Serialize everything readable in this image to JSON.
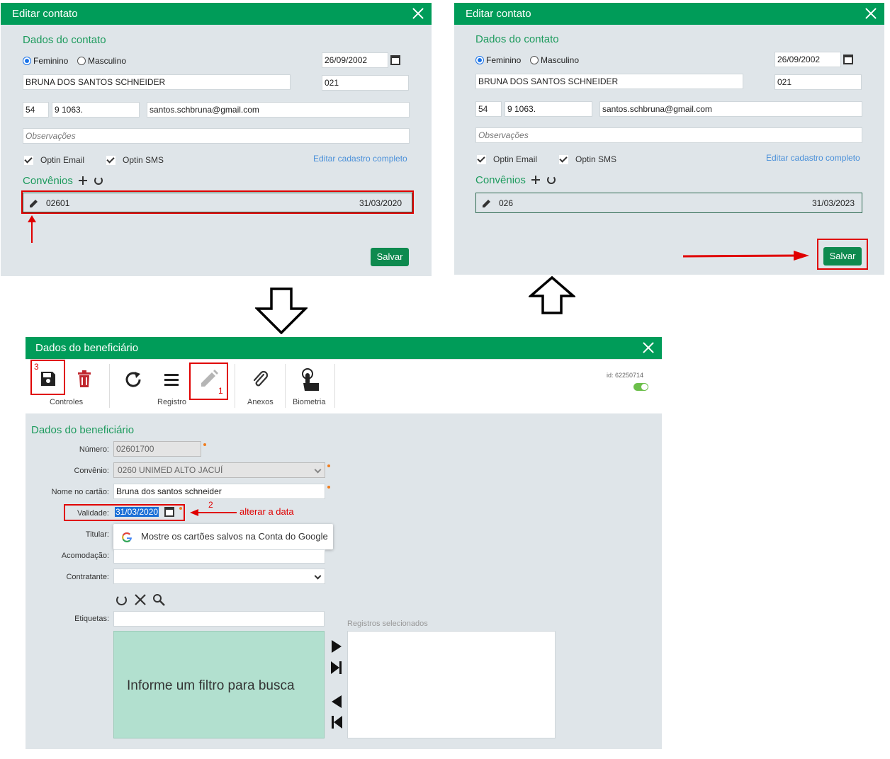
{
  "left_dialog": {
    "title": "Editar contato",
    "section": "Dados do contato",
    "gender_female": "Feminino",
    "gender_male": "Masculino",
    "birthdate": "26/09/2002",
    "name": "BRUNA DOS SANTOS SCHNEIDER",
    "code": "021",
    "ddd": "54",
    "phone": "9 1063.",
    "email": "santos.schbruna@gmail.com",
    "notes_placeholder": "Observações",
    "optin_email": "Optin Email",
    "optin_sms": "Optin SMS",
    "edit_full": "Editar cadastro completo",
    "convenios_title": "Convênios",
    "convenio_code": "02601",
    "convenio_date": "31/03/2020",
    "save": "Salvar"
  },
  "right_dialog": {
    "title": "Editar contato",
    "section": "Dados do contato",
    "gender_female": "Feminino",
    "gender_male": "Masculino",
    "birthdate": "26/09/2002",
    "name": "BRUNA DOS SANTOS SCHNEIDER",
    "code": "021",
    "ddd": "54",
    "phone": "9 1063.",
    "email": "santos.schbruna@gmail.com",
    "notes_placeholder": "Observações",
    "optin_email": "Optin Email",
    "optin_sms": "Optin SMS",
    "edit_full": "Editar cadastro completo",
    "convenios_title": "Convênios",
    "convenio_code": "026",
    "convenio_date": "31/03/2023",
    "save": "Salvar"
  },
  "beneficiary": {
    "title": "Dados do beneficiário",
    "toolbar": {
      "controles": "Controles",
      "registro": "Registro",
      "anexos": "Anexos",
      "biometria": "Biometria",
      "id_label": "id: 62250714"
    },
    "section": "Dados do beneficiário",
    "numero_label": "Número:",
    "numero_value": "02601700",
    "convenio_label": "Convênio:",
    "convenio_value": "0260 UNIMED ALTO JACUÍ",
    "nome_label": "Nome no cartão:",
    "nome_value": "Bruna dos santos schneider",
    "validade_label": "Validade:",
    "validade_value": "31/03/2020",
    "titular_label": "Titular:",
    "autofill": "Mostre os cartões salvos na Conta do Google",
    "acomodacao_label": "Acomodação:",
    "contratante_label": "Contratante:",
    "etiquetas_label": "Etiquetas:",
    "search_hint": "Informe um filtro para busca",
    "selected_title": "Registros selecionados"
  },
  "annotations": {
    "n1": "1",
    "n2": "2",
    "n3": "3",
    "change_date": "alterar a data"
  },
  "colors": {
    "header_green": "#009c59",
    "panel_bg": "#dfe5e9",
    "annotation_red": "#e00000",
    "search_area": "#b2e0cf"
  }
}
